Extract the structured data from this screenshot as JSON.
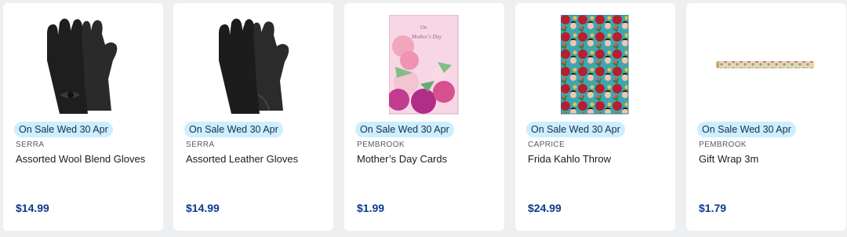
{
  "products": [
    {
      "badge": "On Sale Wed 30 Apr",
      "brand": "SERRA",
      "name": "Assorted Wool Blend Gloves",
      "price": "$14.99",
      "image": "wool-gloves-image"
    },
    {
      "badge": "On Sale Wed 30 Apr",
      "brand": "SERRA",
      "name": "Assorted Leather Gloves",
      "price": "$14.99",
      "image": "leather-gloves-image"
    },
    {
      "badge": "On Sale Wed 30 Apr",
      "brand": "PEMBROOK",
      "name": "Mother’s Day Cards",
      "price": "$1.99",
      "image": "mothers-day-card-image"
    },
    {
      "badge": "On Sale Wed 30 Apr",
      "brand": "CAPRICE",
      "name": "Frida Kahlo Throw",
      "price": "$24.99",
      "image": "frida-kahlo-throw-image"
    },
    {
      "badge": "On Sale Wed 30 Apr",
      "brand": "PEMBROOK",
      "name": "Gift Wrap 3m",
      "price": "$1.79",
      "image": "gift-wrap-image"
    }
  ],
  "colors": {
    "badge_bg": "#cdeeff",
    "price": "#0d3a8c",
    "page_bg": "#eeeff1"
  }
}
